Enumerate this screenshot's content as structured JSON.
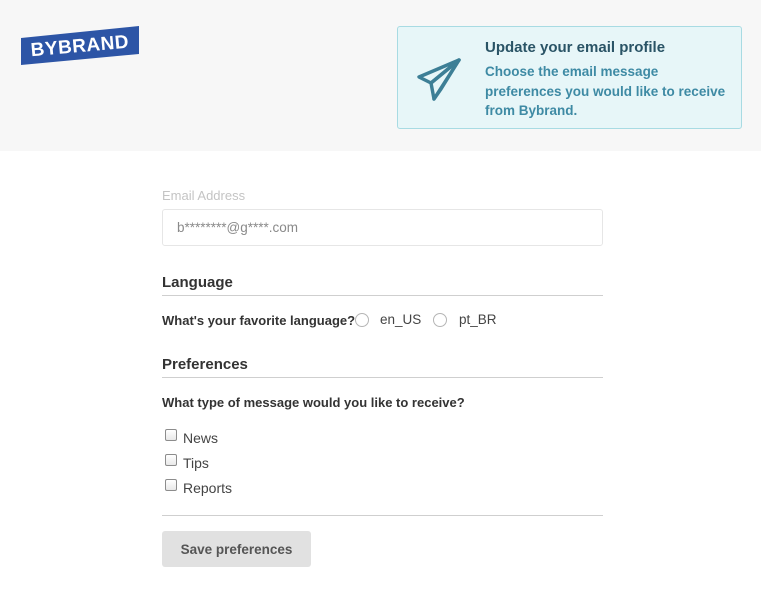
{
  "brand": {
    "logo_text": "BYBRAND",
    "logo_color": "#2d55a6"
  },
  "notice": {
    "title": "Update your email profile",
    "body": "Choose the email message preferences you would like to receive from Bybrand.",
    "icon": "paper-plane-icon",
    "background": "#e7f6f8",
    "accent": "#3e8aa4"
  },
  "form": {
    "email_label": "Email Address",
    "email_value": "b********@g****.com",
    "language": {
      "heading": "Language",
      "question": "What's your favorite language?",
      "options": [
        "en_US",
        "pt_BR"
      ],
      "selected": null
    },
    "preferences": {
      "heading": "Preferences",
      "question": "What type of message would you like to receive?",
      "options": [
        {
          "label": "News",
          "checked": false
        },
        {
          "label": "Tips",
          "checked": false
        },
        {
          "label": "Reports",
          "checked": false
        }
      ]
    },
    "save_label": "Save preferences"
  }
}
